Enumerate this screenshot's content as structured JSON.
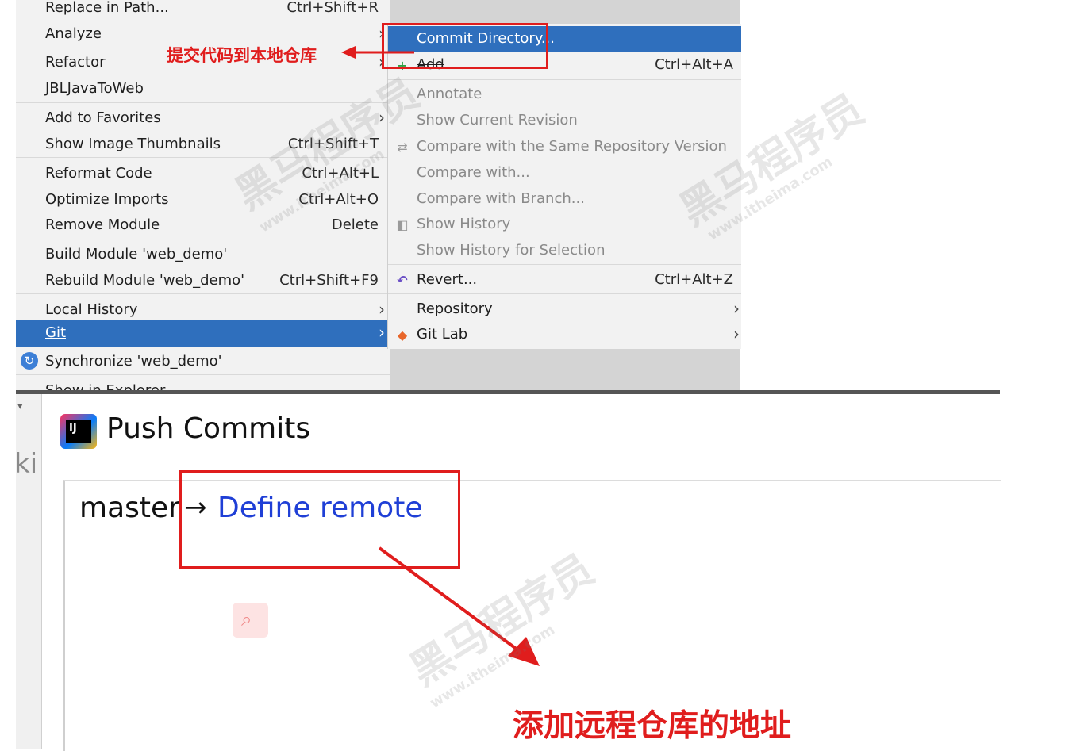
{
  "left_menu": {
    "items": [
      {
        "label": "Replace in Path...",
        "shortcut": "Ctrl+Shift+R"
      },
      {
        "label": "Analyze",
        "shortcut": ""
      },
      {
        "label": "Refactor",
        "shortcut": ""
      },
      {
        "label": "JBLJavaToWeb",
        "shortcut": ""
      },
      {
        "label": "Add to Favorites",
        "shortcut": ""
      },
      {
        "label": "Show Image Thumbnails",
        "shortcut": "Ctrl+Shift+T"
      },
      {
        "label": "Reformat Code",
        "shortcut": "Ctrl+Alt+L"
      },
      {
        "label": "Optimize Imports",
        "shortcut": "Ctrl+Alt+O"
      },
      {
        "label": "Remove Module",
        "shortcut": "Delete"
      },
      {
        "label": "Build Module 'web_demo'",
        "shortcut": ""
      },
      {
        "label": "Rebuild Module 'web_demo'",
        "shortcut": "Ctrl+Shift+F9"
      },
      {
        "label": "Local History",
        "shortcut": ""
      },
      {
        "label": "Git",
        "shortcut": ""
      },
      {
        "label": "Synchronize 'web_demo'",
        "shortcut": ""
      },
      {
        "label": "Show in Explorer",
        "shortcut": ""
      }
    ]
  },
  "git_submenu": {
    "items": [
      {
        "label": "Commit Directory...",
        "shortcut": ""
      },
      {
        "label": "Add",
        "shortcut": "Ctrl+Alt+A"
      },
      {
        "label": "Annotate",
        "shortcut": ""
      },
      {
        "label": "Show Current Revision",
        "shortcut": ""
      },
      {
        "label": "Compare with the Same Repository Version",
        "shortcut": ""
      },
      {
        "label": "Compare with...",
        "shortcut": ""
      },
      {
        "label": "Compare with Branch...",
        "shortcut": ""
      },
      {
        "label": "Show History",
        "shortcut": ""
      },
      {
        "label": "Show History for Selection",
        "shortcut": ""
      },
      {
        "label": "Revert...",
        "shortcut": "Ctrl+Alt+Z"
      },
      {
        "label": "Repository",
        "shortcut": ""
      },
      {
        "label": "Git Lab",
        "shortcut": ""
      }
    ]
  },
  "annotations": {
    "commit_note": "提交代码到本地仓库",
    "remote_note": "添加远程仓库的地址"
  },
  "push_dialog": {
    "title": "Push Commits",
    "branch": "master",
    "arrow": "→",
    "define_remote": "Define remote",
    "side_fragment": "ki"
  },
  "watermark": {
    "cn": "黑马程序员",
    "url": "www.itheima.com"
  },
  "colors": {
    "selection": "#2f6fbd",
    "annotation_red": "#e01d1d",
    "link_blue": "#1f3fd6"
  }
}
